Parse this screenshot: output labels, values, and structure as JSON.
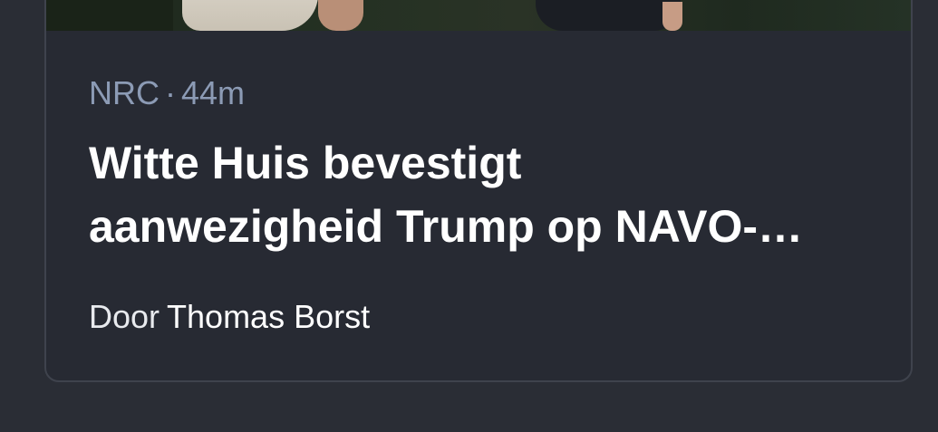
{
  "article": {
    "source": "NRC",
    "separator": "·",
    "age": "44m",
    "headline_line1": "Witte Huis bevestigt",
    "headline_line2": "aanwezigheid Trump op NAVO-…",
    "byline_prefix": "Door",
    "author": "Thomas Borst"
  }
}
